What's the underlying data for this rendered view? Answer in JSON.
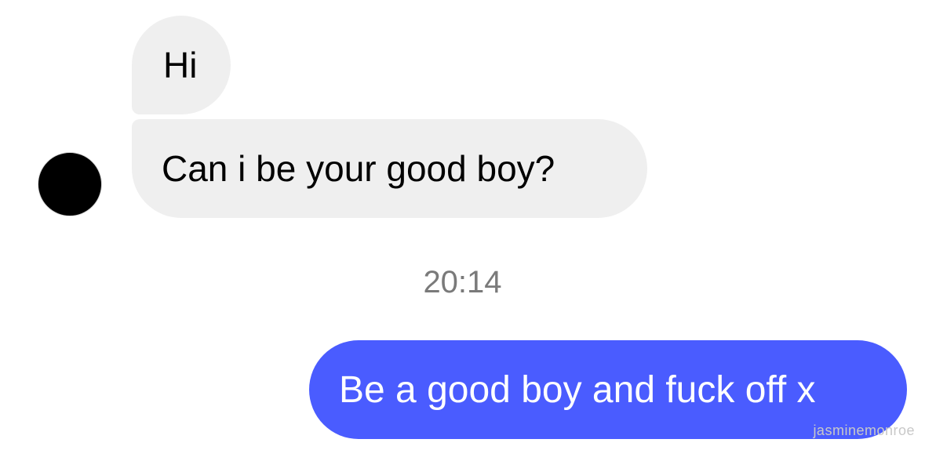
{
  "conversation": {
    "messages": [
      {
        "direction": "incoming",
        "text": "Hi"
      },
      {
        "direction": "incoming",
        "text": "Can i be your good boy?"
      },
      {
        "direction": "outgoing",
        "text": "Be a good boy and fuck off x"
      }
    ],
    "timestamp": "20:14",
    "watermark": "jasminemonroe"
  },
  "colors": {
    "incoming_bubble": "#efefef",
    "outgoing_bubble": "#4a5cff",
    "timestamp_text": "#7a7a7a"
  }
}
